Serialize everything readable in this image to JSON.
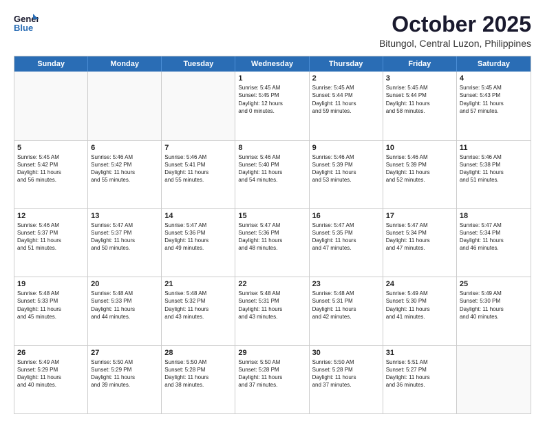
{
  "header": {
    "logo_line1": "General",
    "logo_line2": "Blue",
    "month": "October 2025",
    "location": "Bitungol, Central Luzon, Philippines"
  },
  "weekdays": [
    "Sunday",
    "Monday",
    "Tuesday",
    "Wednesday",
    "Thursday",
    "Friday",
    "Saturday"
  ],
  "weeks": [
    [
      {
        "day": "",
        "info": ""
      },
      {
        "day": "",
        "info": ""
      },
      {
        "day": "",
        "info": ""
      },
      {
        "day": "1",
        "info": "Sunrise: 5:45 AM\nSunset: 5:45 PM\nDaylight: 12 hours\nand 0 minutes."
      },
      {
        "day": "2",
        "info": "Sunrise: 5:45 AM\nSunset: 5:44 PM\nDaylight: 11 hours\nand 59 minutes."
      },
      {
        "day": "3",
        "info": "Sunrise: 5:45 AM\nSunset: 5:44 PM\nDaylight: 11 hours\nand 58 minutes."
      },
      {
        "day": "4",
        "info": "Sunrise: 5:45 AM\nSunset: 5:43 PM\nDaylight: 11 hours\nand 57 minutes."
      }
    ],
    [
      {
        "day": "5",
        "info": "Sunrise: 5:45 AM\nSunset: 5:42 PM\nDaylight: 11 hours\nand 56 minutes."
      },
      {
        "day": "6",
        "info": "Sunrise: 5:46 AM\nSunset: 5:42 PM\nDaylight: 11 hours\nand 55 minutes."
      },
      {
        "day": "7",
        "info": "Sunrise: 5:46 AM\nSunset: 5:41 PM\nDaylight: 11 hours\nand 55 minutes."
      },
      {
        "day": "8",
        "info": "Sunrise: 5:46 AM\nSunset: 5:40 PM\nDaylight: 11 hours\nand 54 minutes."
      },
      {
        "day": "9",
        "info": "Sunrise: 5:46 AM\nSunset: 5:39 PM\nDaylight: 11 hours\nand 53 minutes."
      },
      {
        "day": "10",
        "info": "Sunrise: 5:46 AM\nSunset: 5:39 PM\nDaylight: 11 hours\nand 52 minutes."
      },
      {
        "day": "11",
        "info": "Sunrise: 5:46 AM\nSunset: 5:38 PM\nDaylight: 11 hours\nand 51 minutes."
      }
    ],
    [
      {
        "day": "12",
        "info": "Sunrise: 5:46 AM\nSunset: 5:37 PM\nDaylight: 11 hours\nand 51 minutes."
      },
      {
        "day": "13",
        "info": "Sunrise: 5:47 AM\nSunset: 5:37 PM\nDaylight: 11 hours\nand 50 minutes."
      },
      {
        "day": "14",
        "info": "Sunrise: 5:47 AM\nSunset: 5:36 PM\nDaylight: 11 hours\nand 49 minutes."
      },
      {
        "day": "15",
        "info": "Sunrise: 5:47 AM\nSunset: 5:36 PM\nDaylight: 11 hours\nand 48 minutes."
      },
      {
        "day": "16",
        "info": "Sunrise: 5:47 AM\nSunset: 5:35 PM\nDaylight: 11 hours\nand 47 minutes."
      },
      {
        "day": "17",
        "info": "Sunrise: 5:47 AM\nSunset: 5:34 PM\nDaylight: 11 hours\nand 47 minutes."
      },
      {
        "day": "18",
        "info": "Sunrise: 5:47 AM\nSunset: 5:34 PM\nDaylight: 11 hours\nand 46 minutes."
      }
    ],
    [
      {
        "day": "19",
        "info": "Sunrise: 5:48 AM\nSunset: 5:33 PM\nDaylight: 11 hours\nand 45 minutes."
      },
      {
        "day": "20",
        "info": "Sunrise: 5:48 AM\nSunset: 5:33 PM\nDaylight: 11 hours\nand 44 minutes."
      },
      {
        "day": "21",
        "info": "Sunrise: 5:48 AM\nSunset: 5:32 PM\nDaylight: 11 hours\nand 43 minutes."
      },
      {
        "day": "22",
        "info": "Sunrise: 5:48 AM\nSunset: 5:31 PM\nDaylight: 11 hours\nand 43 minutes."
      },
      {
        "day": "23",
        "info": "Sunrise: 5:48 AM\nSunset: 5:31 PM\nDaylight: 11 hours\nand 42 minutes."
      },
      {
        "day": "24",
        "info": "Sunrise: 5:49 AM\nSunset: 5:30 PM\nDaylight: 11 hours\nand 41 minutes."
      },
      {
        "day": "25",
        "info": "Sunrise: 5:49 AM\nSunset: 5:30 PM\nDaylight: 11 hours\nand 40 minutes."
      }
    ],
    [
      {
        "day": "26",
        "info": "Sunrise: 5:49 AM\nSunset: 5:29 PM\nDaylight: 11 hours\nand 40 minutes."
      },
      {
        "day": "27",
        "info": "Sunrise: 5:50 AM\nSunset: 5:29 PM\nDaylight: 11 hours\nand 39 minutes."
      },
      {
        "day": "28",
        "info": "Sunrise: 5:50 AM\nSunset: 5:28 PM\nDaylight: 11 hours\nand 38 minutes."
      },
      {
        "day": "29",
        "info": "Sunrise: 5:50 AM\nSunset: 5:28 PM\nDaylight: 11 hours\nand 37 minutes."
      },
      {
        "day": "30",
        "info": "Sunrise: 5:50 AM\nSunset: 5:28 PM\nDaylight: 11 hours\nand 37 minutes."
      },
      {
        "day": "31",
        "info": "Sunrise: 5:51 AM\nSunset: 5:27 PM\nDaylight: 11 hours\nand 36 minutes."
      },
      {
        "day": "",
        "info": ""
      }
    ]
  ]
}
